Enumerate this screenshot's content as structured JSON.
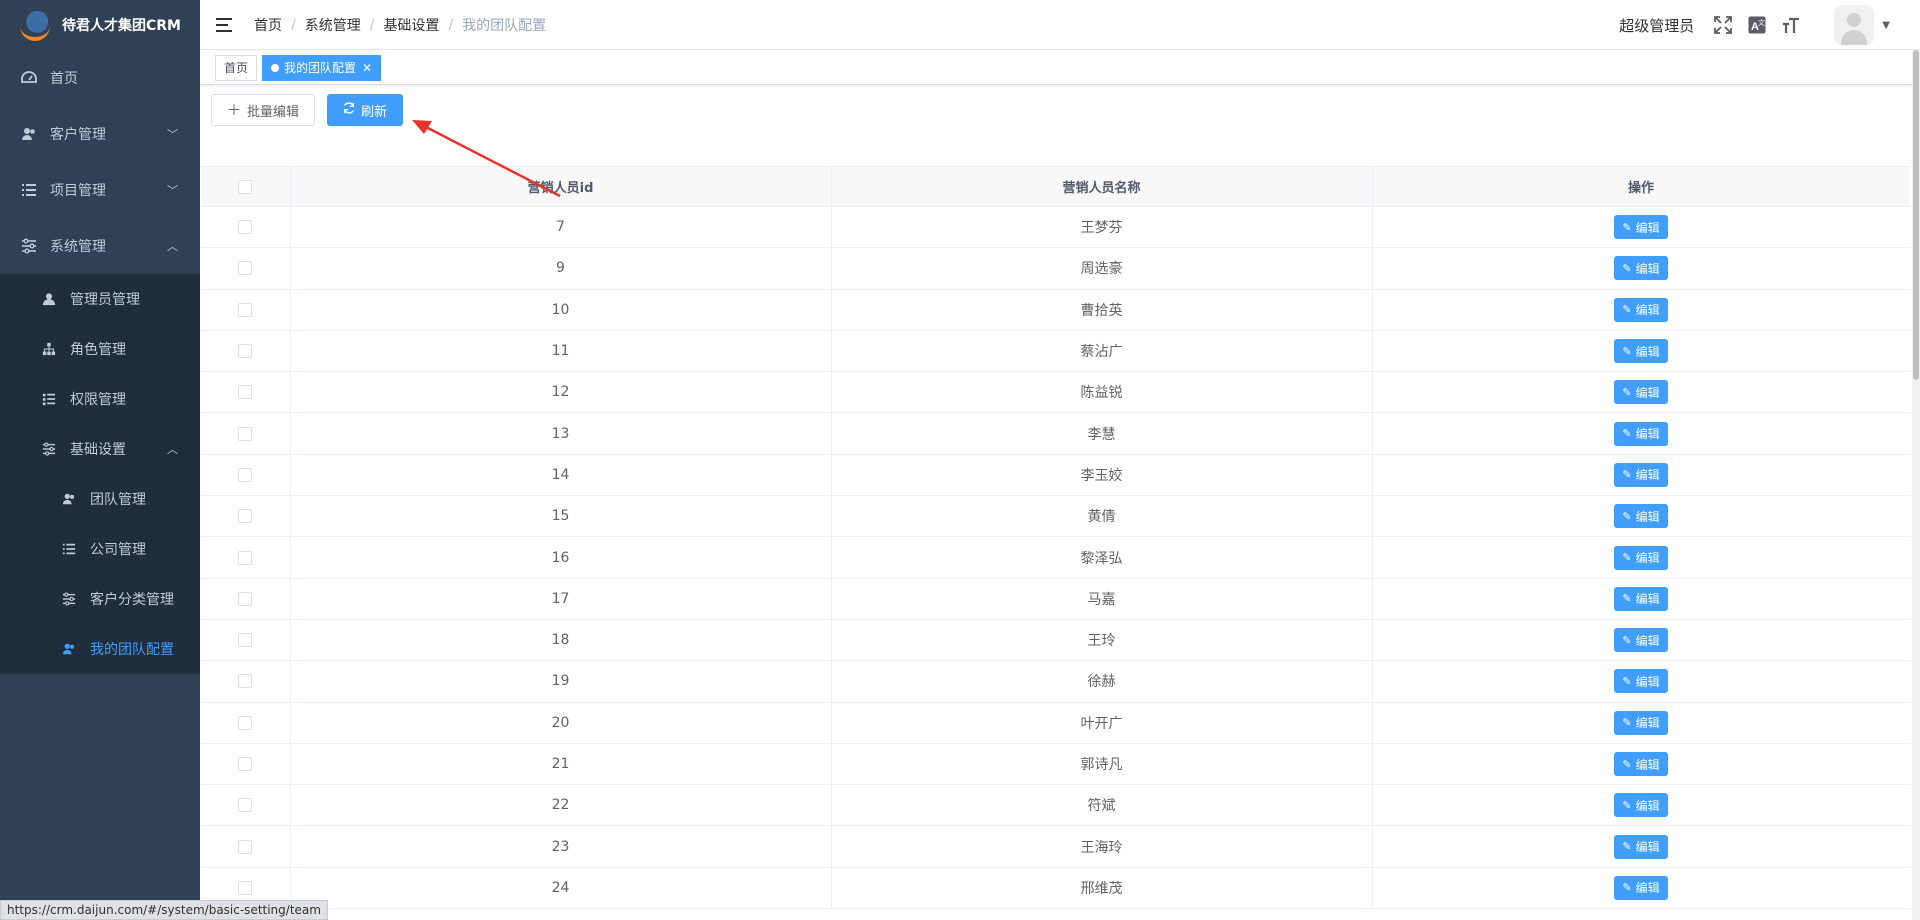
{
  "app": {
    "title": "待君人才集团CRM"
  },
  "sidebar": {
    "items": [
      {
        "label": "首页",
        "icon": "dashboard-icon"
      },
      {
        "label": "客户管理",
        "icon": "users-icon"
      },
      {
        "label": "项目管理",
        "icon": "list-icon"
      },
      {
        "label": "系统管理",
        "icon": "sliders-icon"
      },
      {
        "label": "管理员管理",
        "icon": "user-icon"
      },
      {
        "label": "角色管理",
        "icon": "tree-icon"
      },
      {
        "label": "权限管理",
        "icon": "list-icon"
      },
      {
        "label": "基础设置",
        "icon": "sliders-icon"
      },
      {
        "label": "团队管理",
        "icon": "users-icon"
      },
      {
        "label": "公司管理",
        "icon": "list-icon"
      },
      {
        "label": "客户分类管理",
        "icon": "sliders-icon"
      },
      {
        "label": "我的团队配置",
        "icon": "users-icon"
      }
    ]
  },
  "breadcrumb": {
    "items": [
      "首页",
      "系统管理",
      "基础设置"
    ],
    "current": "我的团队配置"
  },
  "navbar": {
    "user": "超级管理员"
  },
  "tags": {
    "home": "首页",
    "active": "我的团队配置"
  },
  "toolbar": {
    "batch_edit": "批量编辑",
    "refresh": "刷新"
  },
  "table": {
    "headers": [
      "营销人员id",
      "营销人员名称",
      "操作"
    ],
    "edit_label": "编辑",
    "rows": [
      {
        "id": "7",
        "name": "王梦芬"
      },
      {
        "id": "9",
        "name": "周选豪"
      },
      {
        "id": "10",
        "name": "曹拾英"
      },
      {
        "id": "11",
        "name": "蔡沾广"
      },
      {
        "id": "12",
        "name": "陈益锐"
      },
      {
        "id": "13",
        "name": "李慧"
      },
      {
        "id": "14",
        "name": "李玉姣"
      },
      {
        "id": "15",
        "name": "黄倩"
      },
      {
        "id": "16",
        "name": "黎泽弘"
      },
      {
        "id": "17",
        "name": "马嘉"
      },
      {
        "id": "18",
        "name": "王玲"
      },
      {
        "id": "19",
        "name": "徐赫"
      },
      {
        "id": "20",
        "name": "叶开广"
      },
      {
        "id": "21",
        "name": "郭诗凡"
      },
      {
        "id": "22",
        "name": "符斌"
      },
      {
        "id": "23",
        "name": "王海玲"
      },
      {
        "id": "24",
        "name": "邢维茂"
      }
    ]
  },
  "status": {
    "url": "https://crm.daijun.com/#/system/basic-setting/team"
  },
  "colors": {
    "sidebar_bg": "#304156",
    "submenu_bg": "#1f2d3d",
    "primary": "#409eff",
    "annotation": "#e8312a"
  }
}
